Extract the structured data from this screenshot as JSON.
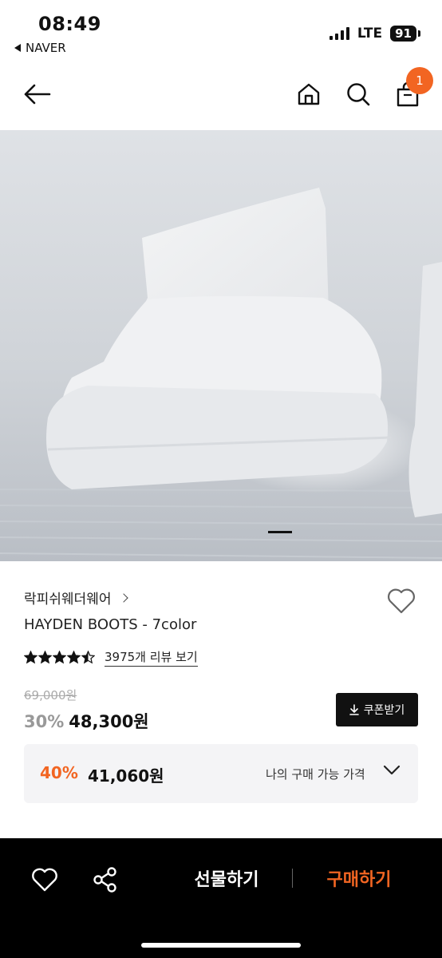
{
  "status_bar": {
    "time": "08:49",
    "back_app": "NAVER",
    "network": "LTE",
    "battery": "91"
  },
  "header": {
    "cart_count": "1"
  },
  "product": {
    "brand": "락피쉬웨더웨어",
    "title": "HAYDEN BOOTS - 7color",
    "rating": 4.5,
    "review_link": "3975개 리뷰 보기",
    "original_price": "69,000원",
    "discount_pct": "30%",
    "sale_price": "48,300원",
    "coupon_button": "쿠폰받기",
    "best_price": {
      "discount_pct": "40%",
      "price": "41,060원",
      "label": "나의 구매 가능 가격"
    }
  },
  "bottom_bar": {
    "gift_label": "선물하기",
    "buy_label": "구매하기"
  },
  "colors": {
    "accent": "#f26522",
    "text": "#111111",
    "muted": "#aaaaaa"
  },
  "icons": [
    "back-arrow-icon",
    "home-icon",
    "search-icon",
    "shopping-bag-icon",
    "heart-icon",
    "share-icon",
    "download-icon",
    "chevron-down-icon",
    "chevron-right-icon",
    "star-icon"
  ]
}
